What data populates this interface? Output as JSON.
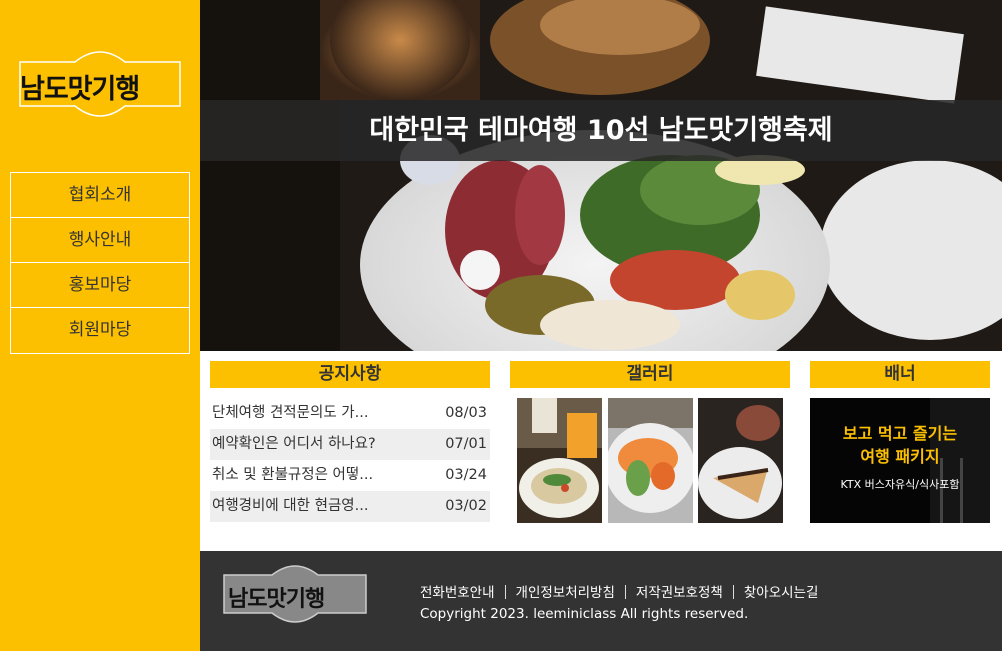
{
  "brand": {
    "logo_text": "남도맛기행",
    "primary_color": "#fcc000",
    "footer_bg": "#333333"
  },
  "nav": {
    "items": [
      {
        "label": "협회소개"
      },
      {
        "label": "행사안내"
      },
      {
        "label": "홍보마당"
      },
      {
        "label": "회원마당"
      }
    ]
  },
  "hero": {
    "title": "대한민국 테마여행 10선 남도맛기행축제"
  },
  "notice": {
    "title": "공지사항",
    "items": [
      {
        "text": "단체여행 견적문의도 가...",
        "date": "08/03"
      },
      {
        "text": "예약확인은 어디서 하나요?",
        "date": "07/01"
      },
      {
        "text": "취소 및 환불규정은 어떻...",
        "date": "03/24"
      },
      {
        "text": "여행경비에 대한 현금영...",
        "date": "03/02"
      }
    ]
  },
  "gallery": {
    "title": "갤러리"
  },
  "banner": {
    "title": "배너",
    "line1": "보고 먹고 즐기는",
    "line2": "여행 패키지",
    "line3": "KTX 버스자유식/식사포함"
  },
  "footer": {
    "links": [
      "전화번호안내",
      "개인정보처리방침",
      "저작권보호정책",
      "찾아오시는길"
    ],
    "copyright": "Copyright 2023. leeminiclass All rights reserved."
  }
}
